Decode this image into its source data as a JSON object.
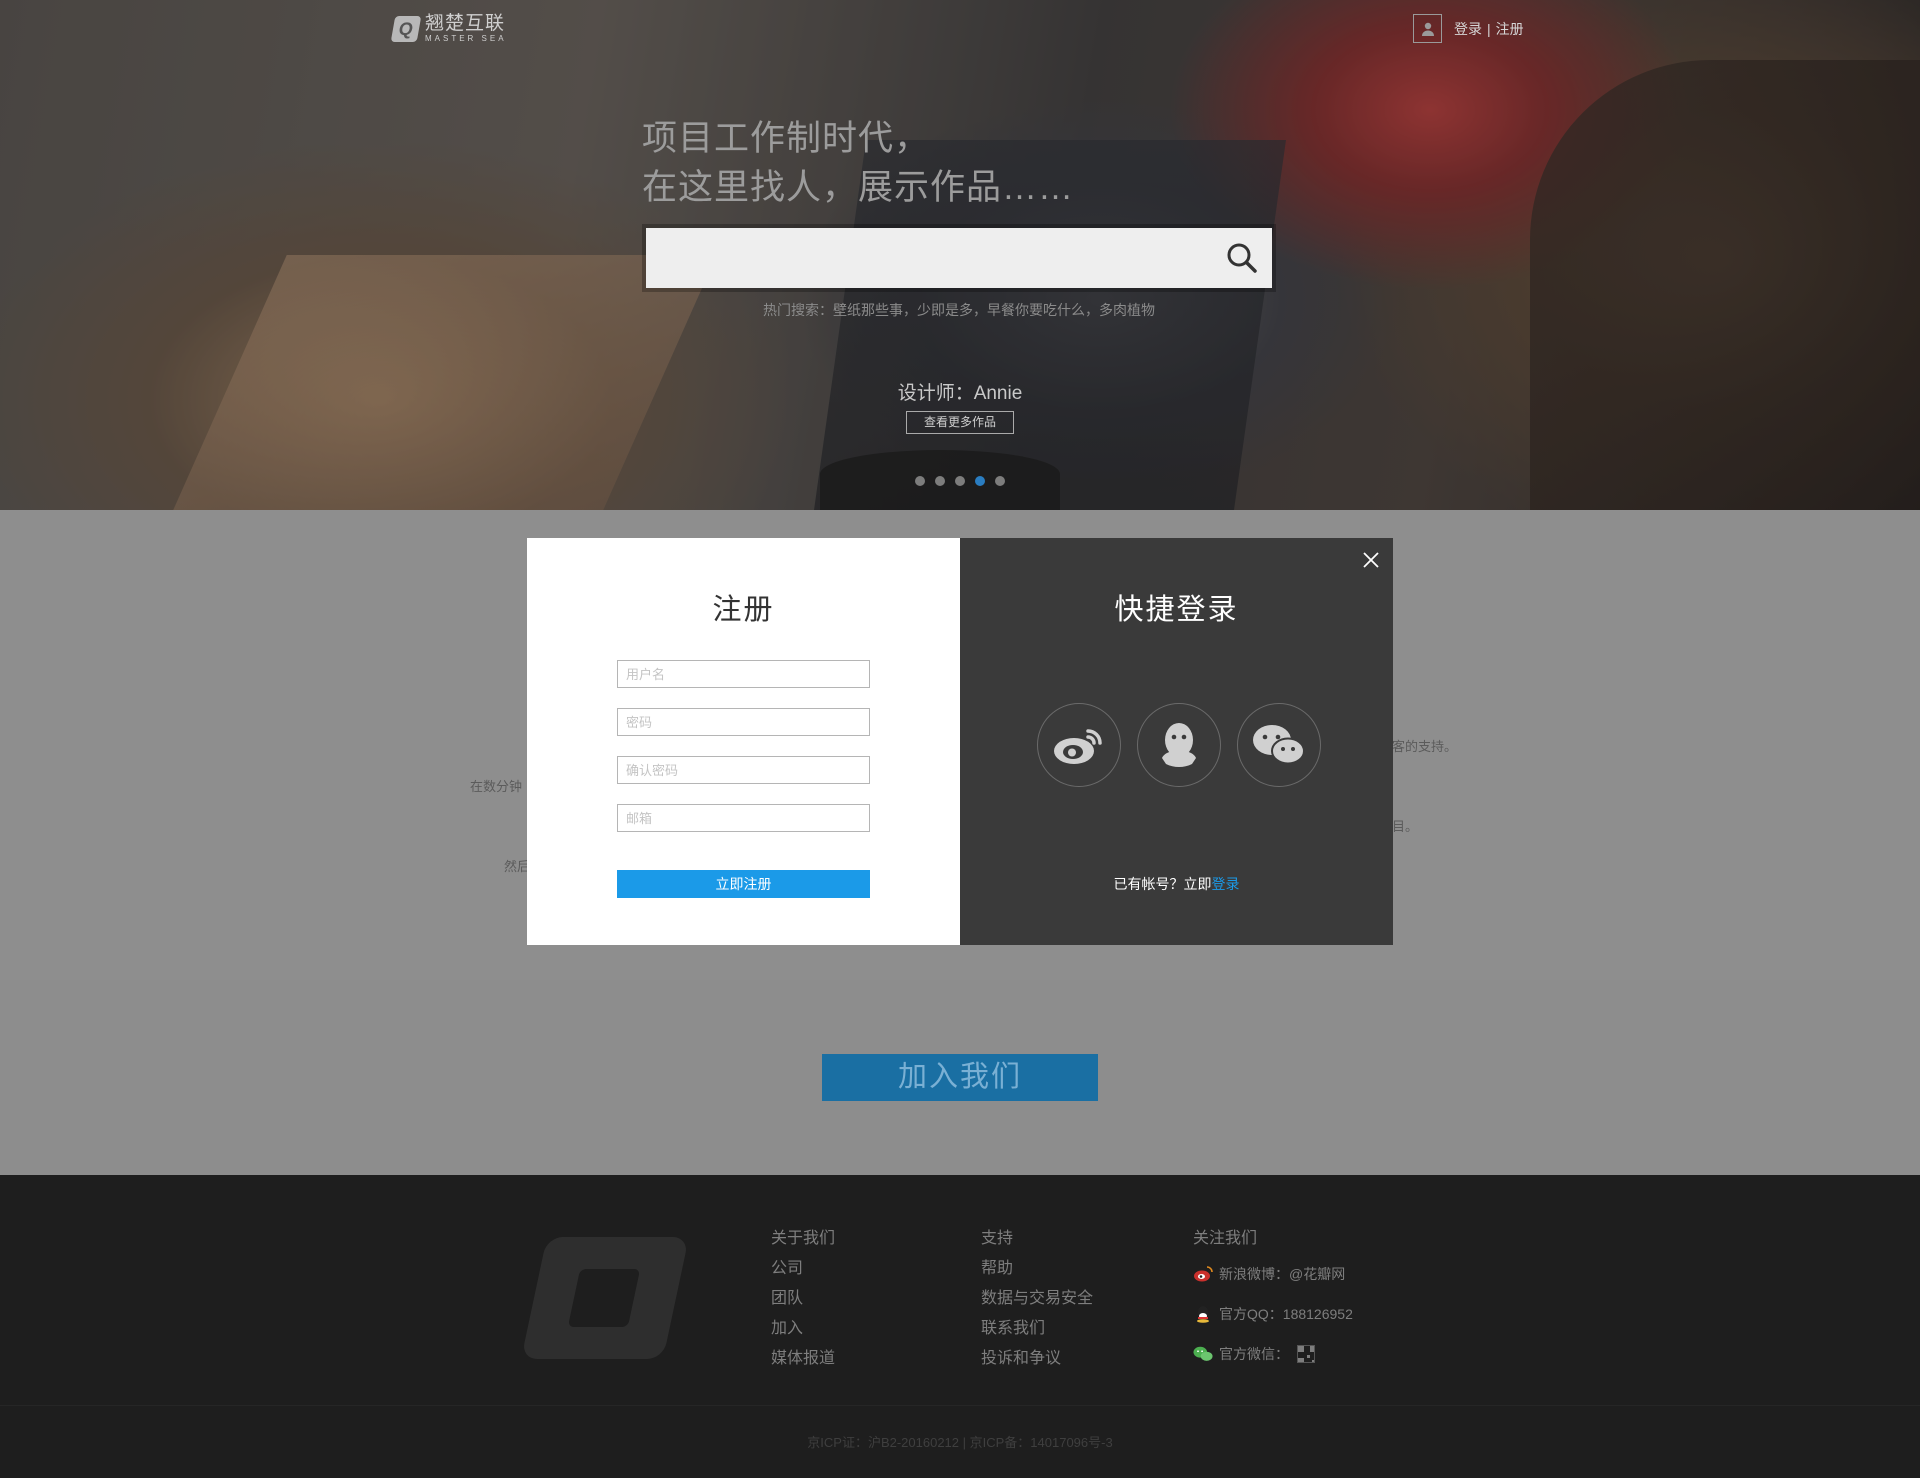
{
  "header": {
    "logo_cn": "翘楚互联",
    "logo_en": "MASTER SEA",
    "login_label": "登录",
    "separator": "|",
    "register_label": "注册"
  },
  "hero": {
    "title_line1": "项目工作制时代，",
    "title_line2": "在这里找人，展示作品……",
    "search_placeholder": "",
    "hot_search": "热门搜索：壁纸那些事，少即是多，早餐你要吃什么，多肉植物",
    "designer": "设计师：Annie",
    "more_works_label": "查看更多作品",
    "carousel_total": 5,
    "carousel_active": 4
  },
  "middle": {
    "fragment_1": "在数分钟",
    "fragment_2": "然后",
    "fragment_3": "客的支持。",
    "fragment_4": "目。",
    "join_label": "加入我们"
  },
  "modal": {
    "register_title": "注册",
    "username_placeholder": "用户名",
    "password_placeholder": "密码",
    "confirm_password_placeholder": "确认密码",
    "email_placeholder": "邮箱",
    "register_button": "立即注册",
    "quick_login_title": "快捷登录",
    "have_account_text": "已有帐号？立即",
    "login_link": "登录",
    "social_icons": [
      "weibo-icon",
      "qq-icon",
      "wechat-icon"
    ]
  },
  "footer": {
    "about": {
      "title": "关于我们",
      "items": [
        "公司",
        "团队",
        "加入",
        "媒体报道"
      ]
    },
    "support": {
      "title": "支持",
      "items": [
        "帮助",
        "数据与交易安全",
        "联系我们",
        "投诉和争议"
      ]
    },
    "follow": {
      "title": "关注我们",
      "weibo": "新浪微博：@花瓣网",
      "qq": "官方QQ：188126952",
      "wechat": "官方微信："
    },
    "icp": "京ICP证：沪B2-20160212 | 京ICP备：14017096号-3"
  },
  "colors": {
    "accent": "#1b9ae8",
    "join_button": "#1a6fa3",
    "modal_dark": "#3a3a3a",
    "footer": "#1e1e1e",
    "carousel_active": "#2a7dc1"
  }
}
